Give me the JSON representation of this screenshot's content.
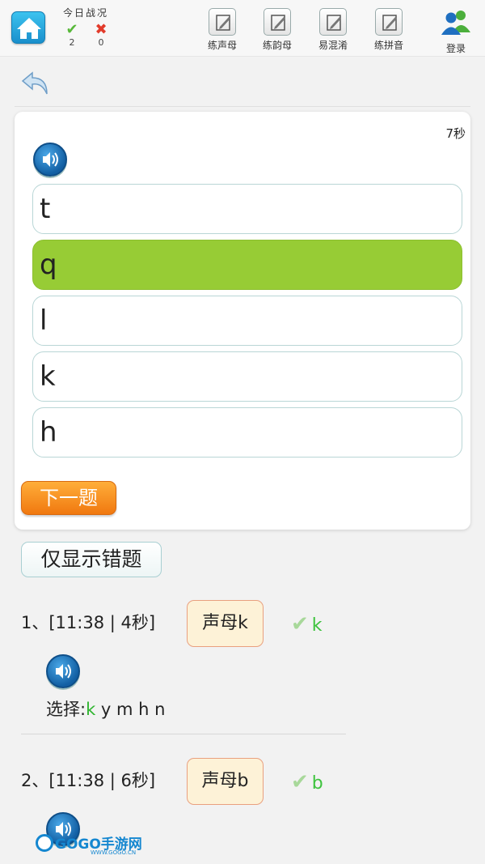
{
  "topbar": {
    "stats_title": "今日战况",
    "correct_count": "2",
    "wrong_count": "0",
    "nav": [
      {
        "label": "练声母"
      },
      {
        "label": "练韵母"
      },
      {
        "label": "易混淆"
      },
      {
        "label": "练拼音"
      }
    ],
    "login_label": "登录"
  },
  "quiz": {
    "timer": "7秒",
    "options": [
      {
        "text": "t",
        "selected": false
      },
      {
        "text": "q",
        "selected": true
      },
      {
        "text": "l",
        "selected": false
      },
      {
        "text": "k",
        "selected": false
      },
      {
        "text": "h",
        "selected": false
      }
    ],
    "next_label": "下一题"
  },
  "history": {
    "wrong_only_label": "仅显示错题",
    "records": [
      {
        "header": "1、[11:38 | 4秒]",
        "tag": "声母k",
        "answer": "k",
        "select_prefix": "选择:",
        "select_highlight": "k",
        "select_rest": " y m h n"
      },
      {
        "header": "2、[11:38 | 6秒]",
        "tag": "声母b",
        "answer": "b"
      }
    ]
  },
  "watermark": {
    "brand": "GOGO手游网",
    "url": "WWW.GOGO.CN"
  },
  "colors": {
    "selected": "#97cc35",
    "next_button": "#f58a1f",
    "correct": "#3ec33e",
    "wrong": "#e23b2b"
  }
}
